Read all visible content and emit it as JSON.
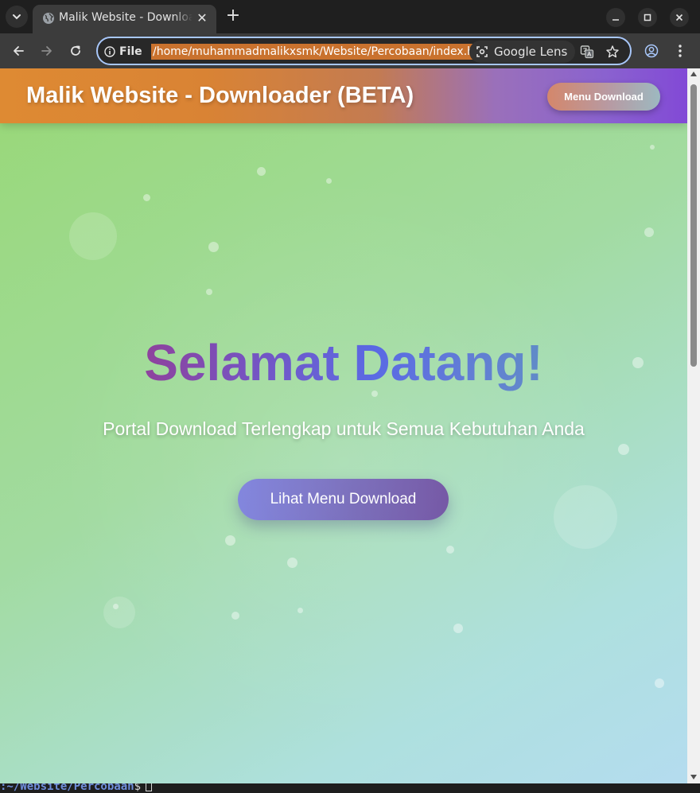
{
  "browser": {
    "tab": {
      "title": "Malik Website - Downloader (BETA)",
      "close_glyph": "✕"
    },
    "new_tab_glyph": "+",
    "omnibox": {
      "scheme_label": "File",
      "url": "/home/muhammadmalikxsmk/Website/Percobaan/index.html",
      "lens_label": "Google Lens"
    },
    "icons": [
      "chevron-down-icon",
      "globe-icon",
      "close-icon",
      "plus-icon",
      "minimize-icon",
      "maximize-icon",
      "close-window-icon",
      "back-icon",
      "forward-icon",
      "reload-icon",
      "info-icon",
      "lens-icon",
      "translate-icon",
      "star-icon",
      "profile-icon",
      "more-vert-icon"
    ]
  },
  "site": {
    "header": {
      "title": "Malik Website - Downloader (BETA)",
      "menu_button": "Menu Download"
    },
    "hero": {
      "title": "Selamat Datang!",
      "subtitle": "Portal Download Terlengkap untuk Semua Kebutuhan Anda",
      "cta": "Lihat Menu Download"
    },
    "colors": {
      "header_start": "#de8a33",
      "header_end": "#8249d6",
      "title_gradient_start": "#8c3e9a",
      "title_gradient_end": "#5d89c6",
      "cta_bg": "#7268c0"
    }
  },
  "terminal": {
    "path": ":~/Website/Percobaan",
    "prompt": "$"
  }
}
